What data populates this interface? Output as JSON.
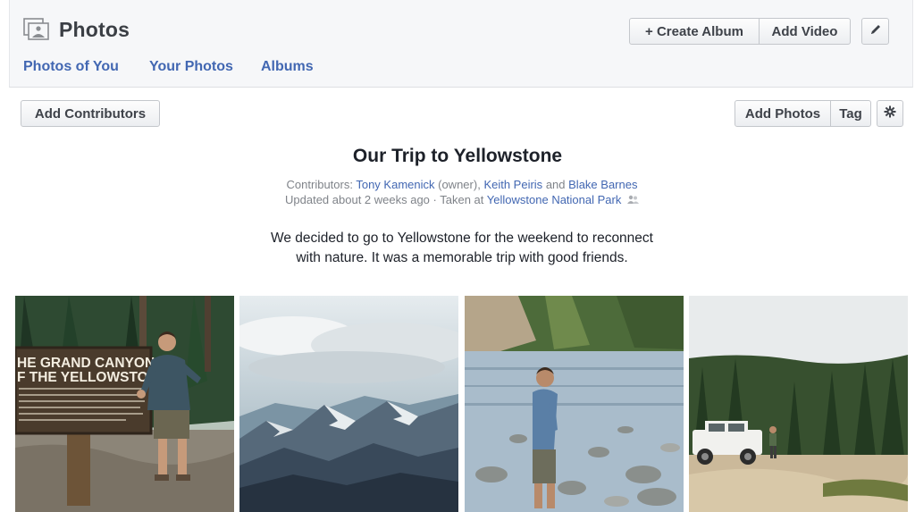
{
  "header": {
    "title": "Photos",
    "tabs": [
      {
        "label": "Photos of You"
      },
      {
        "label": "Your Photos"
      },
      {
        "label": "Albums"
      }
    ],
    "buttons": {
      "create_album": "+ Create Album",
      "add_video": "Add Video",
      "edit_icon": "pencil-icon"
    }
  },
  "toolbar": {
    "add_contributors": "Add Contributors",
    "add_photos": "Add Photos",
    "tag": "Tag",
    "settings_icon": "gear-icon"
  },
  "album": {
    "title": "Our Trip to Yellowstone",
    "contributors_label": "Contributors:",
    "contributors": [
      "Tony Kamenick",
      "Keith Peiris",
      "Blake Barnes"
    ],
    "owner_note": "(owner),",
    "and_word": "and",
    "updated": "Updated about 2 weeks ago",
    "taken_at_prefix": "· Taken at",
    "location": "Yellowstone National Park",
    "description_line_1": "We decided to go to Yellowstone for the weekend to reconnect",
    "description_line_2": "with nature. It was a memorable trip with good friends."
  },
  "photos": [
    {
      "sign_line_1": "HE GRAND CANYON",
      "sign_line_2": "F THE YELLOWSTONE"
    },
    {},
    {},
    {}
  ],
  "colors": {
    "link": "#4267b2",
    "header_bg": "#f6f7f9"
  }
}
